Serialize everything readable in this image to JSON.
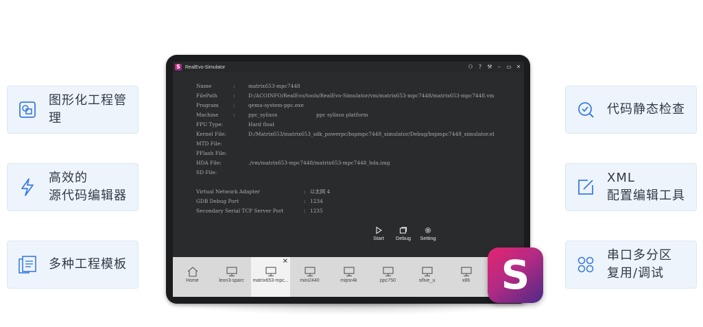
{
  "features": {
    "left": [
      {
        "icon": "project-management-icon",
        "lines": [
          "图形化工程管理"
        ]
      },
      {
        "icon": "lightning-icon",
        "lines": [
          "高效的",
          "源代码编辑器"
        ]
      },
      {
        "icon": "templates-icon",
        "lines": [
          "多种工程模板"
        ]
      }
    ],
    "right": [
      {
        "icon": "code-check-icon",
        "lines": [
          "代码静态检查"
        ]
      },
      {
        "icon": "edit-icon",
        "lines": [
          "XML",
          "配置编辑工具"
        ]
      },
      {
        "icon": "grid-icon",
        "lines": [
          "串口多分区",
          "复用/调试"
        ]
      }
    ]
  },
  "window": {
    "title": "RealEvo-Simulator",
    "logo_letter": "S",
    "controls": [
      "user-icon",
      "help-icon",
      "tools-icon",
      "minimize-icon",
      "maximize-icon",
      "close-icon"
    ],
    "control_glyphs": [
      "⚇",
      "?",
      "⚒",
      "–",
      "▭",
      "✕"
    ]
  },
  "vm_info": [
    {
      "key": "Name",
      "sep": ":",
      "value": "matrix653-mpc7448"
    },
    {
      "key": "FilePath",
      "sep": ":",
      "value": "D:/ACOINFO/RealEvo/tools/RealEvo-Simulator/vm/matrix653-mpc7448/matrix653-mpc7448.vm"
    },
    {
      "key": "Program",
      "sep": ":",
      "value": "qemu-system-ppc.exe"
    },
    {
      "key": "Machine",
      "sep": ":",
      "value": "ppc_sylixos",
      "value2": "ppc sylixos platform"
    },
    {
      "key": "FPU    Type:",
      "sep": "",
      "value": "Hard float"
    },
    {
      "key": "Kernel File:",
      "sep": "",
      "value": "D:/Matrix653/matrix653_sdk_powerpc/bspmpc7448_simulator/Debug/bspmpc7448_simulator.el"
    },
    {
      "key": "MTD    File:",
      "sep": "",
      "value": ""
    },
    {
      "key": "PFlash File:",
      "sep": "",
      "value": ""
    },
    {
      "key": "HDA    File:",
      "sep": "",
      "value": "./vm/matrix653-mpc7448/matrix653-mpc7448_hda.img"
    },
    {
      "key": "SD     File:",
      "sep": "",
      "value": ""
    }
  ],
  "network": [
    {
      "key": "Virtual Network Adapter",
      "sep": ":",
      "value": "以太网 4"
    },
    {
      "key": "GDB Debug Port",
      "sep": ":",
      "value": "1234"
    },
    {
      "key": "Secondary Serial TCP Server Port",
      "sep": ":",
      "value": "1235"
    }
  ],
  "actions": [
    {
      "label": "Start",
      "icon": "play-icon"
    },
    {
      "label": "Debug",
      "icon": "debug-icon"
    },
    {
      "label": "Setting",
      "icon": "gear-icon"
    }
  ],
  "tabs": [
    {
      "label": "Home",
      "icon": "home-icon",
      "active": false
    },
    {
      "label": "leon3-sparc",
      "icon": "monitor-icon",
      "active": false
    },
    {
      "label": "matrix653-mpc...",
      "icon": "monitor-icon",
      "active": true,
      "close": "✕"
    },
    {
      "label": "mini2440",
      "icon": "monitor-icon",
      "active": false
    },
    {
      "label": "mipsr4k",
      "icon": "monitor-icon",
      "active": false
    },
    {
      "label": "ppc750",
      "icon": "monitor-icon",
      "active": false
    },
    {
      "label": "sifive_u",
      "icon": "monitor-icon",
      "active": false
    },
    {
      "label": "x86",
      "icon": "monitor-icon",
      "active": false
    }
  ],
  "brand_logo_letter": "S",
  "colors": {
    "accent_blue": "#3a7be0",
    "card_bg": "#edf4fc",
    "logo_pink": "#e4256f",
    "logo_purple": "#4d2a86"
  }
}
